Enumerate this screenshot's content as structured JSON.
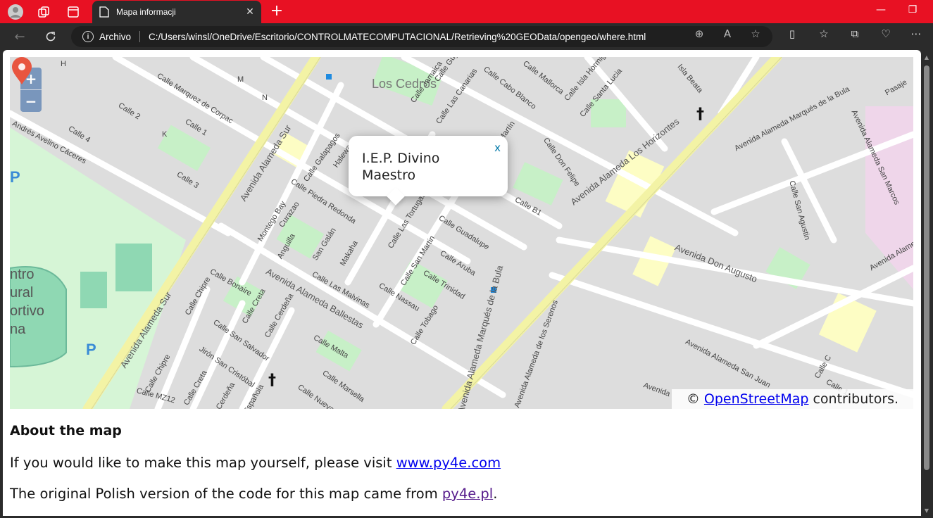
{
  "browser": {
    "tab": {
      "title": "Mapa informacji",
      "close": "✕"
    },
    "address": {
      "scheme": "Archivo",
      "url": "C:/Users/winsl/OneDrive/Escritorio/CONTROLMATECOMPUTACIONAL/Retrieving%20GEOData/opengeo/where.html"
    }
  },
  "map": {
    "zoom_in": "+",
    "zoom_out": "−",
    "popup": {
      "text": "I.E.P. Divino Maestro",
      "close": "x"
    },
    "attribution": {
      "prefix": "©",
      "link": "OpenStreetMap",
      "suffix": "contributors."
    },
    "labels": [
      {
        "text": "Los Cedros",
        "kind": "place"
      },
      {
        "text": "Avenida Alameda Sur",
        "kind": "big"
      },
      {
        "text": "Avenida Alameda Los Horizontes",
        "kind": "big"
      },
      {
        "text": "Avenida Alameda Marqués de la Bula",
        "kind": "big"
      },
      {
        "text": "Avenida Don Augusto",
        "kind": "big"
      },
      {
        "text": "Avenida Alameda Ballestas",
        "kind": "big"
      },
      {
        "text": "Avenida Alameda de los Serenos",
        "kind": "big"
      },
      {
        "text": "Avenida Alameda San Juan",
        "kind": "big"
      },
      {
        "text": "Calle Marquez de Corpac",
        "kind": "small"
      },
      {
        "text": "Calle 2",
        "kind": "small"
      },
      {
        "text": "Calle 1",
        "kind": "small"
      },
      {
        "text": "Calle 4",
        "kind": "small"
      },
      {
        "text": "Calle 3",
        "kind": "small"
      },
      {
        "text": "Calle Galapagos",
        "kind": "small"
      },
      {
        "text": "Calle Piedra Redonda",
        "kind": "small"
      },
      {
        "text": "Montego Bay",
        "kind": "small"
      },
      {
        "text": "Curazao",
        "kind": "small"
      },
      {
        "text": "Anguilla",
        "kind": "small"
      },
      {
        "text": "San Galán",
        "kind": "small"
      },
      {
        "text": "Makaha",
        "kind": "small"
      },
      {
        "text": "Calle Las Tortugas",
        "kind": "small"
      },
      {
        "text": "Calle San Martin",
        "kind": "small"
      },
      {
        "text": "Calle Guadalupe",
        "kind": "small"
      },
      {
        "text": "Calle Aruba",
        "kind": "small"
      },
      {
        "text": "Calle Trinidad",
        "kind": "small"
      },
      {
        "text": "Calle Nassau",
        "kind": "small"
      },
      {
        "text": "Calle Tobago",
        "kind": "small"
      },
      {
        "text": "Calle Las Malvinas",
        "kind": "small"
      },
      {
        "text": "Calle Bonaire",
        "kind": "small"
      },
      {
        "text": "Calle Chipre",
        "kind": "small"
      },
      {
        "text": "Calle Creta",
        "kind": "small"
      },
      {
        "text": "Calle Cerdeña",
        "kind": "small"
      },
      {
        "text": "Calle San Salvador",
        "kind": "small"
      },
      {
        "text": "Jirón San Cristóbal",
        "kind": "small"
      },
      {
        "text": "Calle Malta",
        "kind": "small"
      },
      {
        "text": "Calle Marsella",
        "kind": "small"
      },
      {
        "text": "Calle Mallorca",
        "kind": "small"
      },
      {
        "text": "Calle Cabo Blanco",
        "kind": "small"
      },
      {
        "text": "Calle Jamaica",
        "kind": "small"
      },
      {
        "text": "Calle Las Canarias",
        "kind": "small"
      },
      {
        "text": "Calle Guyanas",
        "kind": "small"
      },
      {
        "text": "Calle Don Felipe",
        "kind": "small"
      },
      {
        "text": "Calle Santa Lucia",
        "kind": "small"
      },
      {
        "text": "Calle Isla Hormiga",
        "kind": "small"
      },
      {
        "text": "Isla Beata",
        "kind": "small"
      },
      {
        "text": "Calle San Agustin",
        "kind": "small"
      },
      {
        "text": "Calle B1",
        "kind": "small"
      },
      {
        "text": "Andrés Avelino Cáceres",
        "kind": "small"
      },
      {
        "text": "Calle MZ12",
        "kind": "small"
      },
      {
        "text": "Calle Nueva",
        "kind": "small"
      },
      {
        "text": "Halewa",
        "kind": "small"
      },
      {
        "text": "Pasaje",
        "kind": "small"
      },
      {
        "text": "Avenida Alameda Marqués de la Bula",
        "kind": "small"
      },
      {
        "text": "Avenida",
        "kind": "small"
      },
      {
        "text": "Calle C",
        "kind": "small"
      },
      {
        "text": "Calle 1",
        "kind": "small"
      },
      {
        "text": "M",
        "kind": "small"
      },
      {
        "text": "N",
        "kind": "small"
      },
      {
        "text": "K",
        "kind": "small"
      },
      {
        "text": "H",
        "kind": "small"
      },
      {
        "text": "Calle Creta",
        "kind": "small"
      },
      {
        "text": "Cerdeña",
        "kind": "small"
      },
      {
        "text": "Española",
        "kind": "small"
      },
      {
        "text": "Calle Chipre",
        "kind": "small"
      },
      {
        "text": "Avenida Alameda San Marcos",
        "kind": "small"
      },
      {
        "text": "Avenida Alameda Los",
        "kind": "small"
      },
      {
        "text": "Martín",
        "kind": "small"
      }
    ],
    "sports_area": [
      "ntro",
      "ural",
      "ortivo",
      "na"
    ],
    "parking": "P"
  },
  "page": {
    "heading": "About the map",
    "line1_text": "If you would like to make this map yourself, please visit",
    "line1_link": "www.py4e.com",
    "line2_text": "The original Polish version of the code for this map came from",
    "line2_link": "py4e.pl",
    "line2_end": "."
  }
}
